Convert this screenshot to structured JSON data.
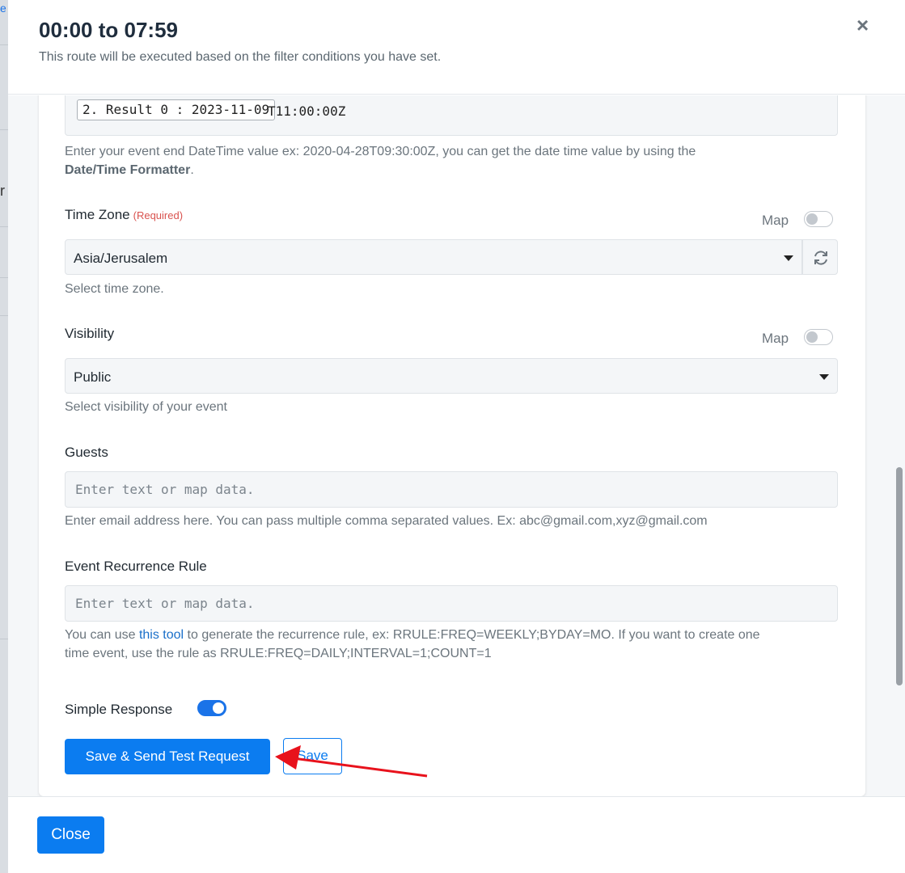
{
  "backdrop": {
    "link_fragment": "e",
    "text_fragment": "r"
  },
  "modal": {
    "title": "00:00 to 07:59",
    "subtitle": "This route will be executed based on the filter conditions you have set.",
    "close_glyph": "×"
  },
  "end_datetime": {
    "token": "2. Result 0 : 2023-11-09",
    "suffix": "T11:00:00Z",
    "help_prefix": "Enter your event end DateTime value ex: 2020-04-28T09:30:00Z, you can get the date time value by using the",
    "help_bold": "Date/Time Formatter",
    "help_suffix": "."
  },
  "time_zone": {
    "label": "Time Zone",
    "required": "(Required)",
    "map_label": "Map",
    "value": "Asia/Jerusalem",
    "help": "Select time zone.",
    "refresh_icon": "refresh-icon"
  },
  "visibility": {
    "label": "Visibility",
    "map_label": "Map",
    "value": "Public",
    "help": "Select visibility of your event"
  },
  "guests": {
    "label": "Guests",
    "placeholder": "Enter text or map data.",
    "help": "Enter email address here. You can pass multiple comma separated values. Ex: abc@gmail.com,xyz@gmail.com"
  },
  "recurrence": {
    "label": "Event Recurrence Rule",
    "placeholder": "Enter text or map data.",
    "help_prefix": "You can use",
    "help_link": "this tool",
    "help_line1_suffix": "to generate the recurrence rule, ex: RRULE:FREQ=WEEKLY;BYDAY=MO. If you want to create one",
    "help_line2": "time event, use the rule as RRULE:FREQ=DAILY;INTERVAL=1;COUNT=1"
  },
  "simple_response": {
    "label": "Simple Response",
    "enabled": true
  },
  "actions": {
    "save_send": "Save & Send Test Request",
    "save": "Save"
  },
  "footer": {
    "close": "Close"
  },
  "colors": {
    "primary": "#0b7cf0",
    "required": "#d9534f",
    "annotation_arrow": "#e8121c"
  }
}
